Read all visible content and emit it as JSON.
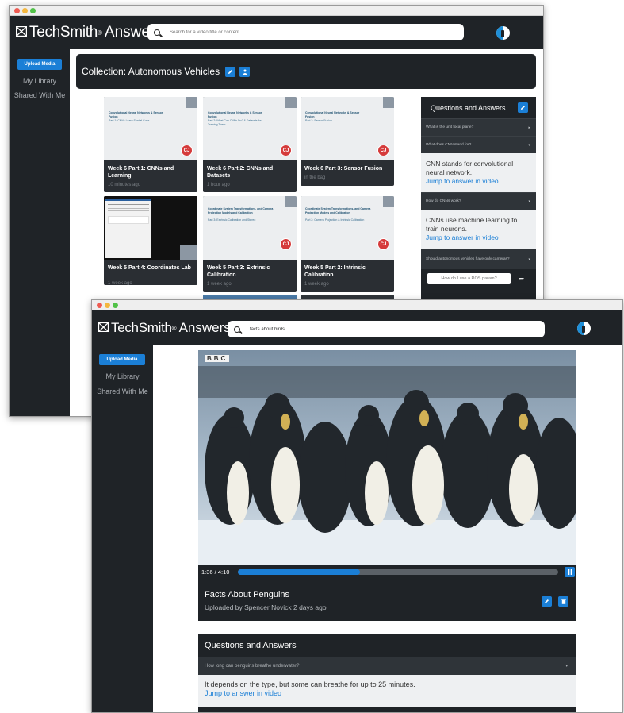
{
  "brand": {
    "name": "TechSmith",
    "mark": "®",
    "product": "Answers"
  },
  "sidebar": {
    "upload_label": "Upload Media",
    "my_library": "My Library",
    "shared": "Shared With Me"
  },
  "back_window": {
    "search_placeholder": "Search for a video title or content",
    "collection_title": "Collection: Autonomous Vehicles",
    "cards": [
      {
        "thumb_title": "Convolutional Neural Networks & Sensor Fusion",
        "thumb_sub": "Part 1: CNNs Learn Spatial Cues",
        "title": "Week 6 Part 1: CNNs and Learning",
        "time": "10 minutes ago",
        "badge": "CJ"
      },
      {
        "thumb_title": "Convolutional Neural Networks & Sensor Fusion",
        "thumb_sub": "Part 2: What Can CNNs Do? & Datasets for Training Them",
        "title": "Week 6 Part 2: CNNs and Datasets",
        "time": "1 hour ago",
        "badge": "CJ"
      },
      {
        "thumb_title": "Convolutional Neural Networks & Sensor Fusion",
        "thumb_sub": "Part 3: Sensor Fusion",
        "title": "Week 6 Part 3: Sensor Fusion",
        "time": "in the bag",
        "badge": "CJ"
      },
      {
        "thumb_title": "",
        "thumb_sub": "",
        "title": "Week 5 Part 4: Coordinates Lab",
        "time": "1 week ago",
        "badge": ""
      },
      {
        "thumb_title": "Coordinate System Transformations, and Camera Projection Models and Calibration",
        "thumb_sub": "Part 3: Extrinsic Calibration and Stereo",
        "title": "Week 5 Part 3: Extrinsic Calibration",
        "time": "1 week ago",
        "badge": "CJ"
      },
      {
        "thumb_title": "Coordinate System Transformations, and Camera Projection Models and Calibration",
        "thumb_sub": "Part 2: Camera Projection & Intrinsic Calibration",
        "title": "Week 5 Part 2: Intrinsic Calibration",
        "time": "1 week ago",
        "badge": "CJ"
      }
    ],
    "qa": {
      "title": "Questions and Answers",
      "items": [
        {
          "q": "What is the unit focal plane?",
          "open": false,
          "a": ""
        },
        {
          "q": "What does CNN stand for?",
          "open": true,
          "a": "CNN stands for convolutional neural network."
        },
        {
          "q": "How do CNNs work?",
          "open": true,
          "a": "CNNs use machine learning to train neurons."
        },
        {
          "q": "Should autonomous vehicles have only cameras?",
          "open": false,
          "a": ""
        }
      ],
      "jump_label": "Jump to answer in video",
      "ask_placeholder": "How do I use a ROS param?"
    }
  },
  "front_window": {
    "search_value": "facts about birds",
    "video": {
      "watermark": "BBC",
      "time": "1:36 / 4:10",
      "progress": 0.38
    },
    "title": "Facts About Penguins",
    "uploaded": "Uploaded by Spencer Novick 2 days ago",
    "qa": {
      "title": "Questions and Answers",
      "question": "How long can penguins breathe underwater?",
      "answer": "It depends on the type, but some can breathe for up to 25 minutes.",
      "jump_label": "Jump to answer in video"
    }
  }
}
